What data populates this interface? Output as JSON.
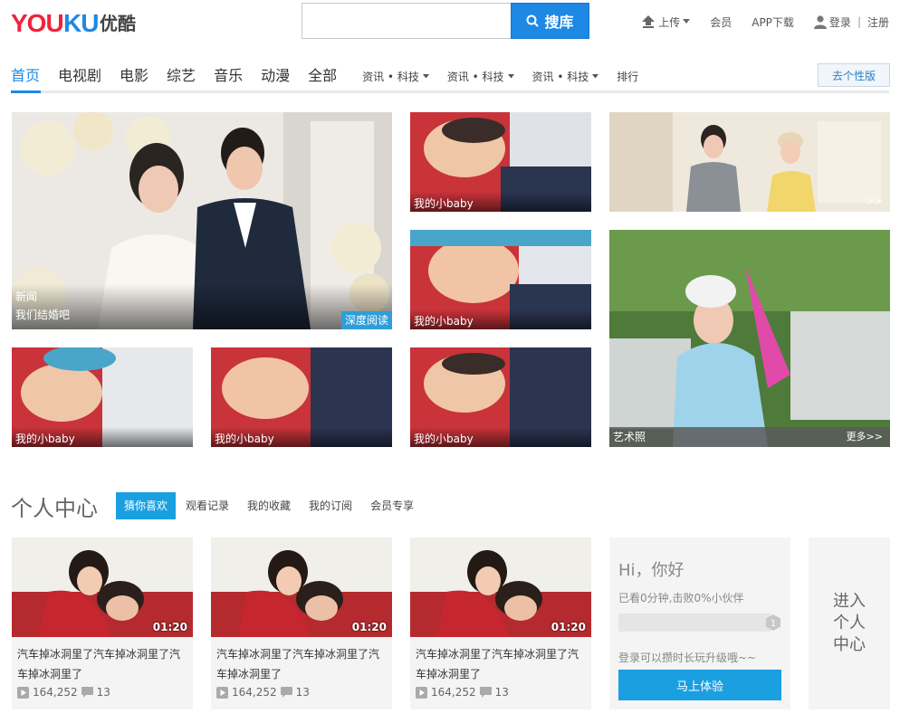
{
  "header": {
    "logo_text": "YOUKU",
    "logo_cn": "优酷",
    "search": {
      "value": "",
      "placeholder": "",
      "button_label": "搜库"
    },
    "links": {
      "upload": "上传",
      "vip": "会员",
      "app": "APP下载",
      "login": "登录",
      "register": "注册"
    }
  },
  "nav": {
    "items": [
      "首页",
      "电视剧",
      "电影",
      "综艺",
      "音乐",
      "动漫",
      "全部"
    ],
    "sub_items": [
      "资讯 • 科技",
      "资讯 • 科技",
      "资讯 • 科技"
    ],
    "rank": "排行",
    "personal": "去个性版"
  },
  "tiles": {
    "big": {
      "category": "新闻",
      "title": "我们结婚吧",
      "badge": "深度阅读"
    },
    "baby": "我的小baby",
    "top_right_more": ">>",
    "art": {
      "title": "艺术照",
      "more": "更多>>"
    }
  },
  "personal": {
    "title": "个人中心",
    "tabs": [
      "猜你喜欢",
      "观看记录",
      "我的收藏",
      "我的订阅",
      "会员专享"
    ],
    "cards": [
      {
        "duration": "01:20",
        "title": "汽车掉冰洞里了汽车掉冰洞里了汽车掉冰洞里了",
        "plays": "164,252",
        "comments": "13"
      },
      {
        "duration": "01:20",
        "title": "汽车掉冰洞里了汽车掉冰洞里了汽车掉冰洞里了",
        "plays": "164,252",
        "comments": "13"
      },
      {
        "duration": "01:20",
        "title": "汽车掉冰洞里了汽车掉冰洞里了汽车掉冰洞里了",
        "plays": "164,252",
        "comments": "13"
      }
    ],
    "hi": {
      "greeting": "Hi，你好",
      "stat": "已看0分钟,击败0%小伙伴",
      "level": "1",
      "tip": "登录可以攒时长玩升级哦~~",
      "button": "马上体验"
    },
    "enter": "进入个人中心"
  },
  "colors": {
    "accent": "#1e88e5",
    "tab_active": "#1a9fe0"
  }
}
